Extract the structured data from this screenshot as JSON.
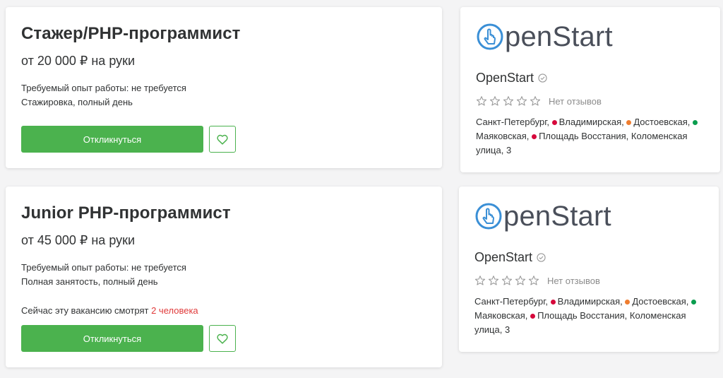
{
  "vacancies": [
    {
      "title": "Стажер/PHP-программист",
      "salary": "от 20 000 ₽ на руки",
      "experience": "Требуемый опыт работы: не требуется",
      "schedule": "Стажировка, полный день",
      "respond_label": "Откликнуться"
    },
    {
      "title": "Junior PHP-программист",
      "salary": "от 45 000 ₽ на руки",
      "experience": "Требуемый опыт работы: не требуется",
      "schedule": "Полная занятость, полный день",
      "watchers_prefix": "Сейчас эту вакансию смотрят ",
      "watchers_count": "2 человека",
      "respond_label": "Откликнуться"
    }
  ],
  "companies": [
    {
      "logo_text": "penStart",
      "name": "OpenStart",
      "rating_stars": 0,
      "reviews": "Нет отзывов",
      "city": "Санкт-Петербург,",
      "metro": [
        {
          "name": "Владимирская,",
          "color": "#d6083b"
        },
        {
          "name": "Достоевская,",
          "color": "#ef7d2f"
        },
        {
          "name": "Маяковская,",
          "color": "#0a9d4e"
        },
        {
          "name": "Площадь Восстания,",
          "color": "#d6083b"
        }
      ],
      "street": "Коломенская улица, 3"
    },
    {
      "logo_text": "penStart",
      "name": "OpenStart",
      "rating_stars": 0,
      "reviews": "Нет отзывов",
      "city": "Санкт-Петербург,",
      "metro": [
        {
          "name": "Владимирская,",
          "color": "#d6083b"
        },
        {
          "name": "Достоевская,",
          "color": "#ef7d2f"
        },
        {
          "name": "Маяковская,",
          "color": "#0a9d4e"
        },
        {
          "name": "Площадь Восстания,",
          "color": "#d6083b"
        }
      ],
      "street": "Коломенская улица, 3"
    }
  ],
  "icons": {
    "favorite": "heart-icon",
    "verified": "check-circle-icon",
    "star": "star-outline-icon",
    "logo": "hand-pointer-icon"
  },
  "colors": {
    "accent": "#4bb24e",
    "highlight": "#e03a3a",
    "logo_blue": "#3a8fd6"
  }
}
